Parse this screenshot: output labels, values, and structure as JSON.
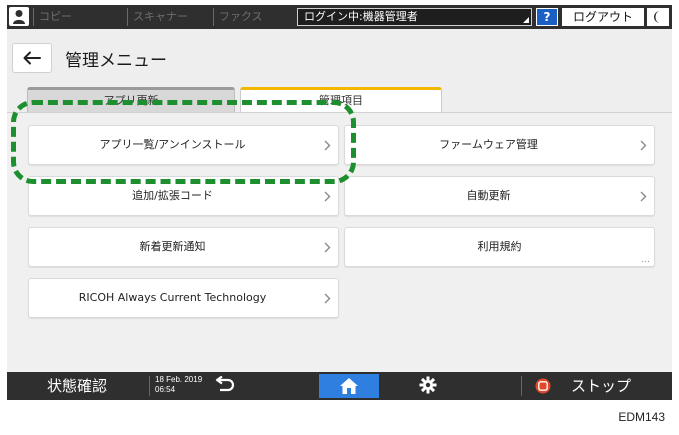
{
  "topbar": {
    "tabs": [
      "コピー",
      "スキャナー",
      "ファクス"
    ],
    "login_status": "ログイン中:機器管理者",
    "help_label": "?",
    "logout_label": "ログアウト"
  },
  "header": {
    "title": "管理メニュー"
  },
  "tabs": [
    {
      "label": "アプリ更新",
      "active": false
    },
    {
      "label": "管理項目",
      "active": true
    }
  ],
  "items": [
    {
      "label": "アプリ一覧/アンインストール"
    },
    {
      "label": "ファームウェア管理"
    },
    {
      "label": "追加/拡張コード"
    },
    {
      "label": "自動更新"
    },
    {
      "label": "新着更新通知"
    },
    {
      "label": "利用規約",
      "more": "..."
    },
    {
      "label": "RICOH Always Current Technology"
    }
  ],
  "bottombar": {
    "status_label": "状態確認",
    "date": "18 Feb. 2019",
    "time": "06:54",
    "stop_label": "ストップ"
  },
  "colors": {
    "active_tab_accent": "#f2b800",
    "home_button": "#2f7fe0",
    "help_button": "#1b5fc4",
    "highlight_annotation": "#1e8f2e",
    "stop_icon": "#e04a2a"
  },
  "figure_code": "EDM143"
}
